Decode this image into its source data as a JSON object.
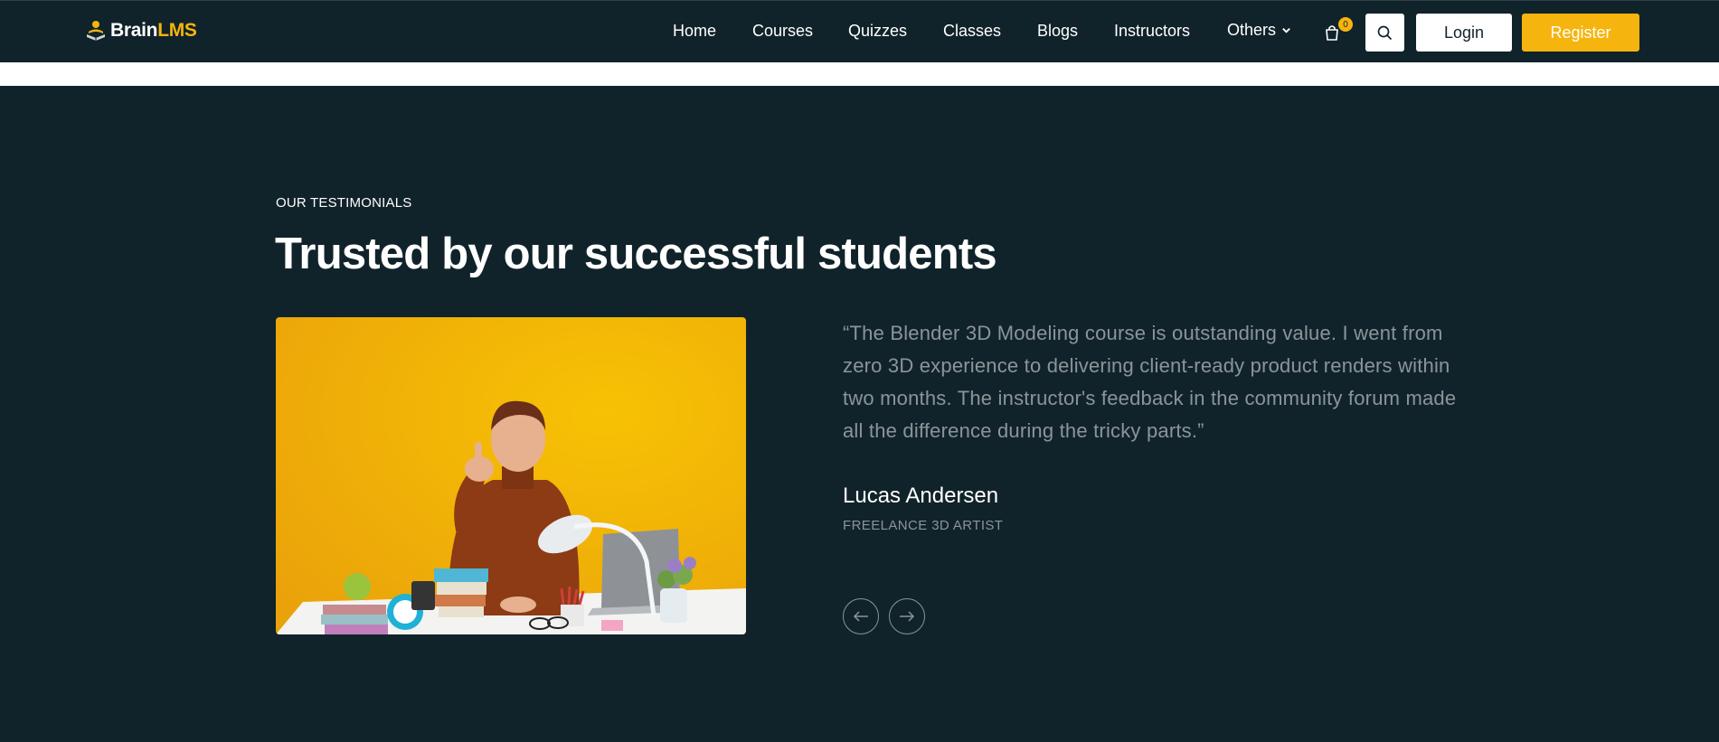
{
  "header": {
    "logo": {
      "brain": "Brain",
      "lms": "LMS",
      "icon": "book-reader-icon"
    },
    "nav": [
      {
        "label": "Home"
      },
      {
        "label": "Courses"
      },
      {
        "label": "Quizzes"
      },
      {
        "label": "Classes"
      },
      {
        "label": "Blogs"
      },
      {
        "label": "Instructors"
      },
      {
        "label": "Others"
      }
    ],
    "cart_count": "0",
    "login_label": "Login",
    "register_label": "Register"
  },
  "testimonials": {
    "eyebrow": "OUR TESTIMONIALS",
    "title": "Trusted by our successful students",
    "quote": "“The Blender 3D Modeling course is outstanding value. I went from zero 3D experience to delivering client-ready product renders within two months. The instructor's feedback in the community forum made all the difference during the tricky parts.”",
    "author": "Lucas Andersen",
    "role": "FREELANCE 3D ARTIST"
  },
  "colors": {
    "background": "#11232a",
    "accent": "#f6b40e",
    "muted_text": "#8a959a"
  }
}
